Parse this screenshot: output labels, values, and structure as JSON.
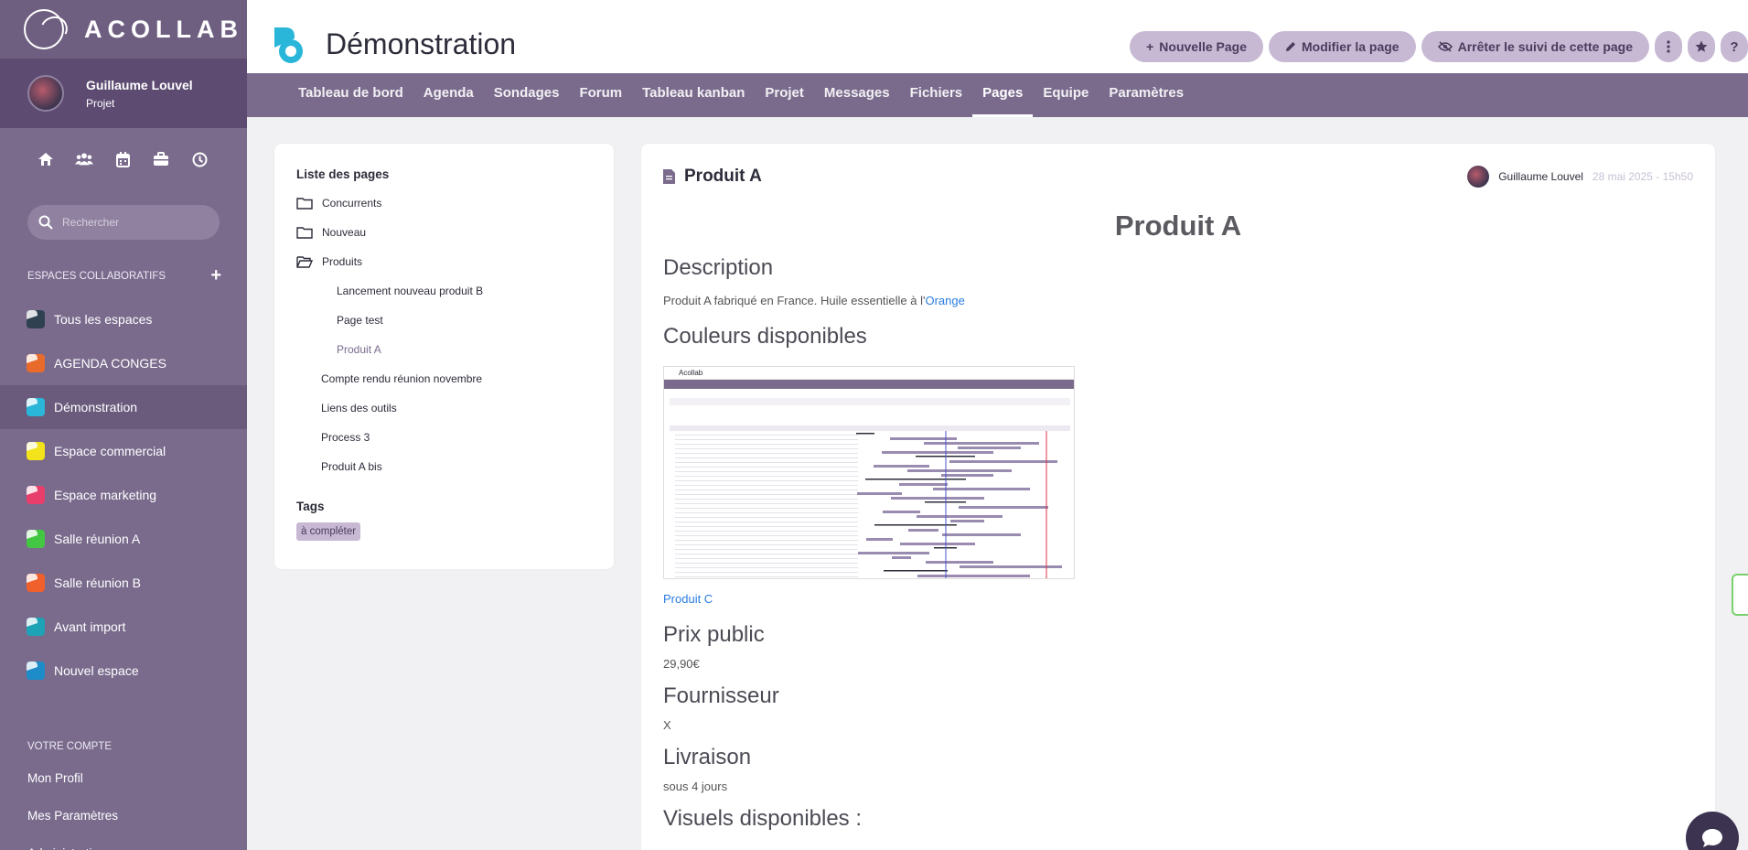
{
  "sidebar": {
    "logo_text": "ACOLLAB",
    "user": {
      "name": "Guillaume Louvel",
      "role": "Projet"
    },
    "icons": [
      "home-icon",
      "users-icon",
      "calendar-icon",
      "briefcase-icon",
      "clock-icon"
    ],
    "search_placeholder": "Rechercher",
    "spaces_title": "ESPACES COLLABORATIFS",
    "spaces": [
      {
        "label": "Tous les espaces",
        "color": "#2f4050",
        "accent": "#ffffff"
      },
      {
        "label": "AGENDA CONGES",
        "color": "#e86b2c",
        "accent": "#ffffff"
      },
      {
        "label": "Démonstration",
        "color": "#29b6d9",
        "accent": "#ffffff"
      },
      {
        "label": "Espace commercial",
        "color": "#f2e31b",
        "accent": "#ffffff"
      },
      {
        "label": "Espace marketing",
        "color": "#e83e6c",
        "accent": "#ffffff"
      },
      {
        "label": "Salle réunion A",
        "color": "#43c743",
        "accent": "#ffffff"
      },
      {
        "label": "Salle réunion B",
        "color": "#f0602c",
        "accent": "#ffffff"
      },
      {
        "label": "Avant import",
        "color": "#1ea2b5",
        "accent": "#ffffff"
      },
      {
        "label": "Nouvel espace",
        "color": "#1e8cc8",
        "accent": "#ffffff"
      }
    ],
    "account_title": "VOTRE COMPTE",
    "account_links": [
      "Mon Profil",
      "Mes Paramètres",
      "Administration"
    ]
  },
  "header": {
    "title": "Démonstration",
    "buttons": {
      "new_page": "Nouvelle Page",
      "edit_page": "Modifier la page",
      "unfollow": "Arrêter le suivi de cette page"
    }
  },
  "tabs": [
    "Tableau de bord",
    "Agenda",
    "Sondages",
    "Forum",
    "Tableau kanban",
    "Projet",
    "Messages",
    "Fichiers",
    "Pages",
    "Equipe",
    "Paramètres"
  ],
  "active_tab": "Pages",
  "pages_list": {
    "title": "Liste des pages",
    "items": [
      {
        "label": "Concurrents",
        "level": 0,
        "folder": "closed"
      },
      {
        "label": "Nouveau",
        "level": 0,
        "folder": "closed"
      },
      {
        "label": "Produits",
        "level": 0,
        "folder": "open"
      },
      {
        "label": "Lancement nouveau produit B",
        "level": 2
      },
      {
        "label": "Page test",
        "level": 2
      },
      {
        "label": "Produit A",
        "level": 2,
        "current": true
      },
      {
        "label": "Compte rendu réunion novembre",
        "level": 1
      },
      {
        "label": "Liens des outils",
        "level": 1
      },
      {
        "label": "Process 3",
        "level": 1
      },
      {
        "label": "Produit A bis",
        "level": 1
      }
    ],
    "tags_title": "Tags",
    "tags": [
      "à compléter"
    ]
  },
  "document": {
    "title": "Produit A",
    "author": "Guillaume Louvel",
    "date": "28 mai 2025 - 15h50",
    "heading": "Produit A",
    "description_title": "Description",
    "description_text": "Produit A fabriqué en France. Huile essentielle à l'",
    "description_link": "Orange",
    "colors_title": "Couleurs disponibles",
    "screenshot_label": "Acollab",
    "image_link": "Produit C",
    "price_title": "Prix public",
    "price": "29,90€",
    "supplier_title": "Fournisseur",
    "supplier": "X",
    "delivery_title": "Livraison",
    "delivery": "sous 4 jours",
    "visuals_title": "Visuels disponibles :"
  }
}
